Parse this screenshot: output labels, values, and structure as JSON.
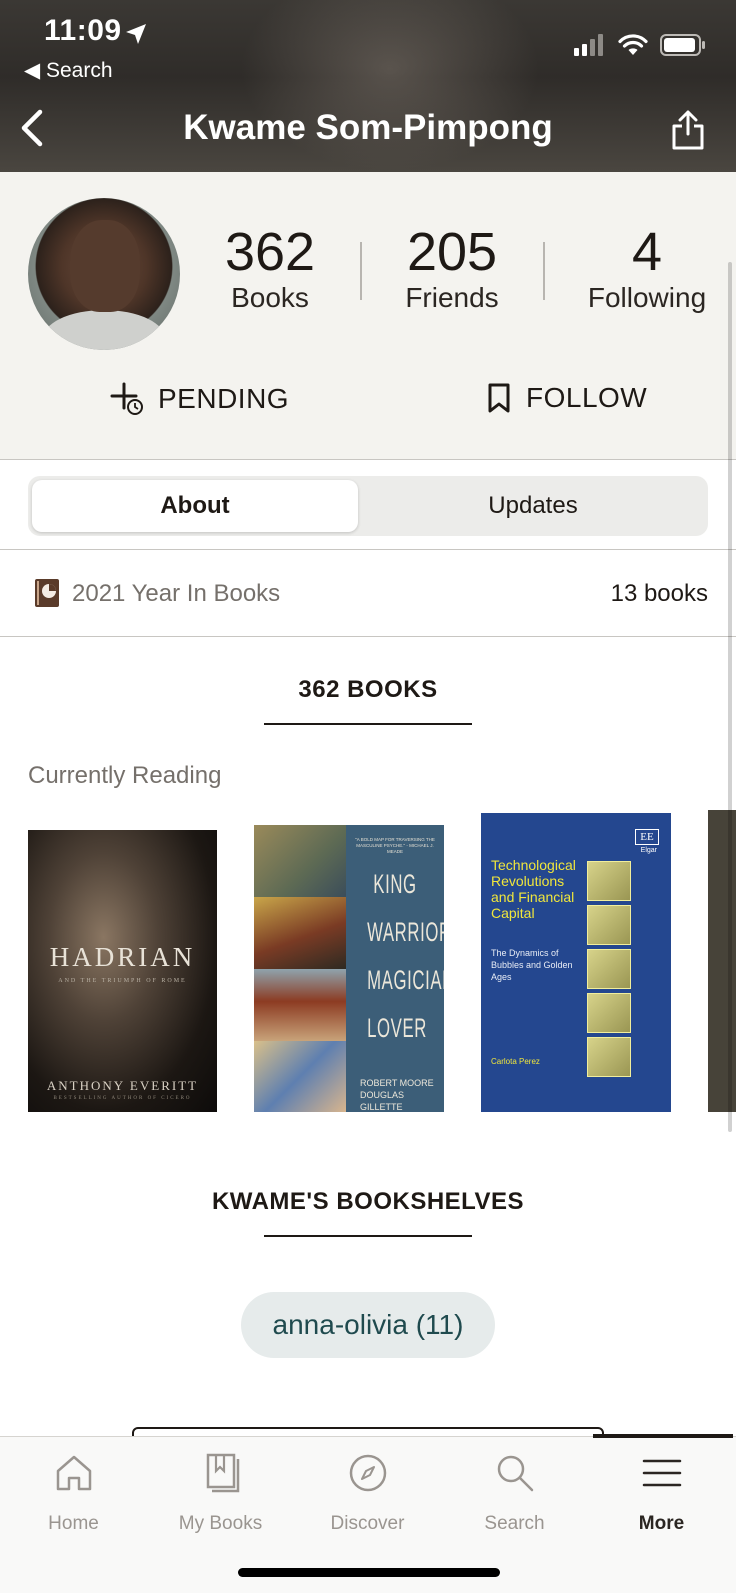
{
  "status_bar": {
    "time": "11:09",
    "back_app": "Search"
  },
  "nav": {
    "title": "Kwame Som-Pimpong"
  },
  "profile": {
    "stats": [
      {
        "value": "362",
        "label": "Books"
      },
      {
        "value": "205",
        "label": "Friends"
      },
      {
        "value": "4",
        "label": "Following"
      }
    ],
    "actions": {
      "pending": "PENDING",
      "follow": "FOLLOW"
    }
  },
  "segments": {
    "about": "About",
    "updates": "Updates",
    "selected": "About"
  },
  "year_in_books": {
    "label": "2021 Year In Books",
    "count": "13 books"
  },
  "books_section": {
    "title": "362 BOOKS",
    "currently_reading": "Currently Reading",
    "covers": [
      {
        "title": "HADRIAN",
        "subtitle": "AND THE TRIUMPH OF ROME",
        "author": "ANTHONY EVERITT",
        "tagline": "BESTSELLING AUTHOR OF CICERO"
      },
      {
        "words": [
          "KING",
          "WARRIOR",
          "MAGICIAN",
          "LOVER"
        ],
        "quote": "\"A BOLD MAP FOR TRAVERSING THE MASCULINE PSYCHE.\" - MICHAEL J. MEADE",
        "authors": [
          "ROBERT MOORE",
          "DOUGLAS GILLETTE"
        ]
      },
      {
        "publisher_mark": "EE",
        "publisher": "Elgar",
        "title": "Technological Revolutions and Financial Capital",
        "subtitle": "The Dynamics of Bubbles and Golden Ages",
        "author": "Carlota Perez"
      }
    ]
  },
  "shelves_section": {
    "title": "KWAME'S BOOKSHELVES",
    "shelves": [
      {
        "label": "anna-olivia (11)"
      }
    ]
  },
  "tabbar": {
    "tabs": [
      {
        "label": "Home",
        "icon": "home-icon"
      },
      {
        "label": "My Books",
        "icon": "my-books-icon"
      },
      {
        "label": "Discover",
        "icon": "compass-icon"
      },
      {
        "label": "Search",
        "icon": "search-icon"
      },
      {
        "label": "More",
        "icon": "menu-icon"
      }
    ],
    "active": "More"
  }
}
